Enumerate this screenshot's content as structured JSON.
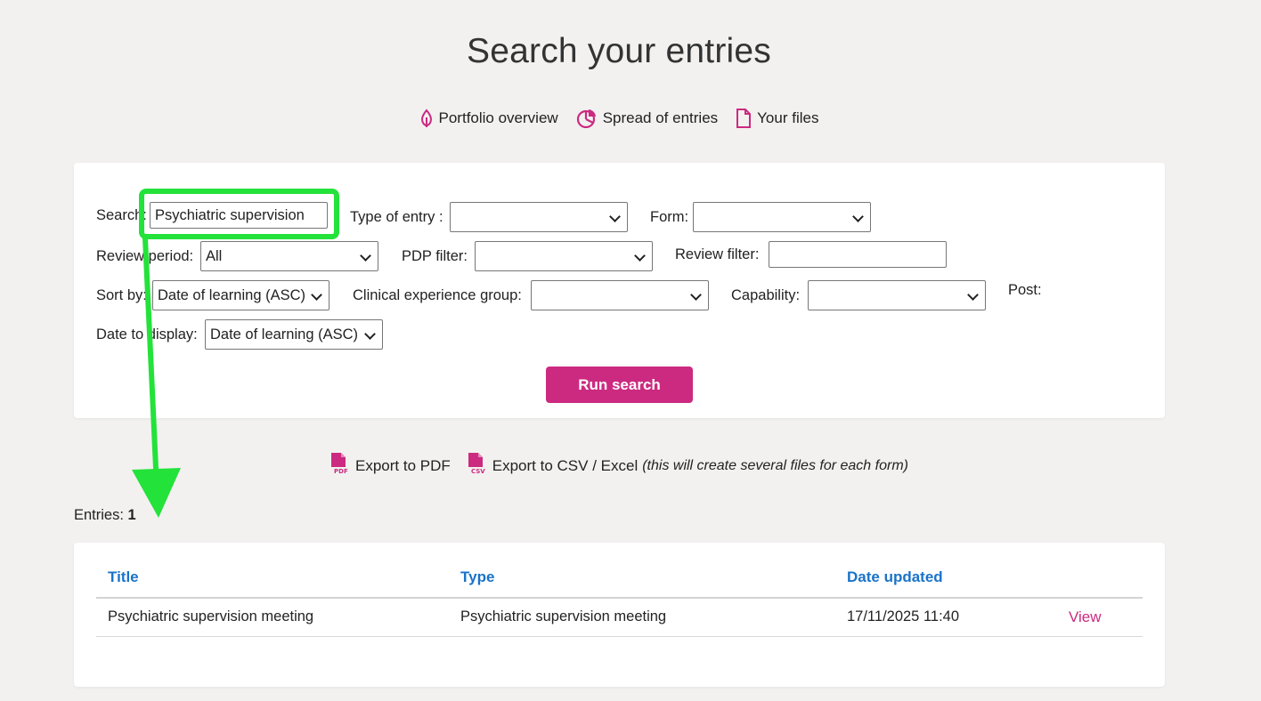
{
  "page": {
    "title": "Search your entries"
  },
  "quick_nav": [
    {
      "label": "Portfolio overview",
      "icon": "leaf-icon"
    },
    {
      "label": "Spread of entries",
      "icon": "pie-chart-icon"
    },
    {
      "label": "Your files",
      "icon": "file-icon"
    }
  ],
  "search_form": {
    "search_label": "Search:",
    "search_value": "Psychiatric supervision",
    "type_of_entry_label": "Type of entry :",
    "type_of_entry_value": "",
    "form_label": "Form:",
    "form_value": "",
    "review_period_label": "Review period:",
    "review_period_value": "All",
    "pdp_filter_label": "PDP filter:",
    "pdp_filter_value": "",
    "review_filter_label": "Review filter:",
    "review_filter_value": "",
    "sort_by_label": "Sort by:",
    "sort_by_value": "Date of learning (ASC)",
    "clinical_group_label": "Clinical experience group:",
    "clinical_group_value": "",
    "capability_label": "Capability:",
    "capability_value": "",
    "post_label": "Post:",
    "date_display_label": "Date to display:",
    "date_display_value": "Date of learning (ASC)",
    "run_button": "Run search"
  },
  "export": {
    "pdf_label": "Export to PDF",
    "csv_label": "Export to CSV / Excel",
    "csv_note": "(this will create several files for each form)"
  },
  "entries": {
    "label": "Entries:",
    "count": "1"
  },
  "table": {
    "headers": {
      "title": "Title",
      "type": "Type",
      "date_updated": "Date updated"
    },
    "rows": [
      {
        "title": "Psychiatric supervision meeting",
        "type": "Psychiatric supervision meeting",
        "date_updated": "17/11/2025 11:40",
        "action": "View"
      }
    ]
  },
  "colors": {
    "accent": "#cc2a80",
    "link_blue": "#1a73c8",
    "annotation_green": "#23e23a",
    "background": "#f2f1f0"
  }
}
